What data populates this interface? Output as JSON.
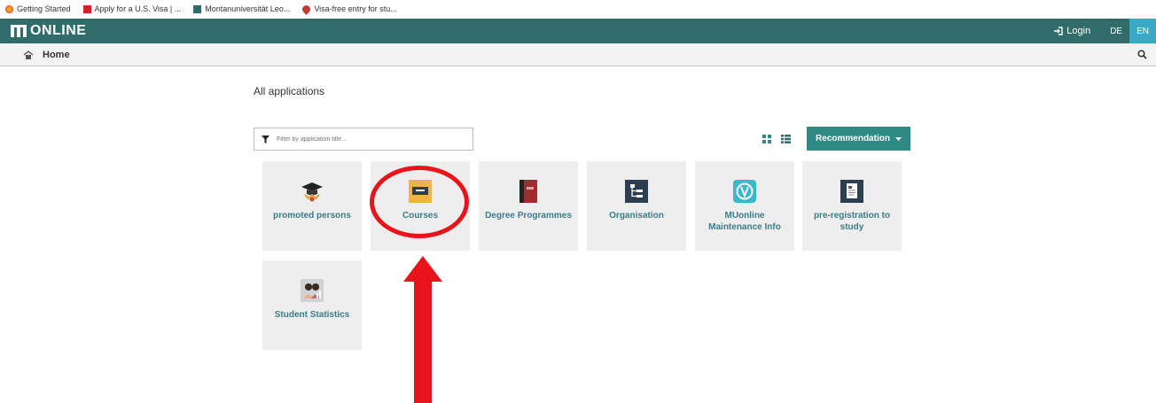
{
  "bookmarks": [
    {
      "label": "Getting Started",
      "icon": "firefox-icon"
    },
    {
      "label": "Apply for a U.S. Visa | ...",
      "icon": "visa-icon"
    },
    {
      "label": "Montanuniversität Leo...",
      "icon": "mu-icon"
    },
    {
      "label": "Visa-free entry for stu...",
      "icon": "pin-icon"
    }
  ],
  "header": {
    "logo_text": "ONLINE",
    "login_label": "Login",
    "lang_de": "DE",
    "lang_en": "EN",
    "brand_color": "#2f6c6a"
  },
  "breadcrumb": {
    "home_label": "Home"
  },
  "main": {
    "title": "All applications",
    "filter_placeholder": "Filter by application title...",
    "recommendation_label": "Recommendation"
  },
  "tiles": [
    {
      "label": "promoted persons",
      "icon": "graduation-cap-icon"
    },
    {
      "label": "Courses",
      "icon": "chalkboard-icon"
    },
    {
      "label": "Degree Programmes",
      "icon": "book-icon"
    },
    {
      "label": "Organisation",
      "icon": "org-chart-icon"
    },
    {
      "label": "MUonline Maintenance Info",
      "icon": "maintenance-icon"
    },
    {
      "label": "pre-registration to study",
      "icon": "document-icon"
    },
    {
      "label": "Student Statistics",
      "icon": "students-icon"
    }
  ],
  "annotation_color": "#e8141b"
}
